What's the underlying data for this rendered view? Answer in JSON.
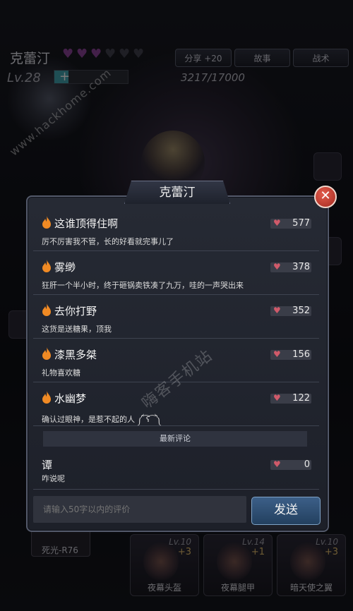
{
  "character": {
    "name": "克蕾汀",
    "level_label": "Lv.28",
    "hearts_filled": 3,
    "hearts_total": 6,
    "xp_text": "3217/17000",
    "xp_progress": 0.19,
    "xp_plus": "+"
  },
  "top_tabs": {
    "share": "分享 +20",
    "story": "故事",
    "tactics": "战术"
  },
  "watermark": {
    "url": "www.hackhome.com",
    "site": "嗨客手机站"
  },
  "modal": {
    "title": "克蕾汀",
    "close_label": "✕",
    "hot_comments": [
      {
        "user": "这谁顶得住啊",
        "likes": "577",
        "text": "厉不厉害我不管，长的好看就完事儿了"
      },
      {
        "user": "雾缈",
        "likes": "378",
        "text": "狂肝一个半小时，终于砸锅卖铁凑了九万，哇的一声哭出来"
      },
      {
        "user": "去你打野",
        "likes": "352",
        "text": "这货是送糖果，顶我"
      },
      {
        "user": "漆黑多桀",
        "likes": "156",
        "text": "礼物喜欢糖"
      },
      {
        "user": "水幽梦",
        "likes": "122",
        "text": "确认过眼神，是惹不起的人 ༼ ͡ʕ ͡ ༽"
      }
    ],
    "latest_label": "最新评论",
    "latest_comments": [
      {
        "user": "谭",
        "likes": "0",
        "text": "咋说呢"
      }
    ],
    "input_placeholder": "请输入50字以内的评价",
    "send_label": "发送"
  },
  "equipment": [
    {
      "name": "夜幕头盔",
      "level": "Lv.10",
      "plus": "+3"
    },
    {
      "name": "夜幕腿甲",
      "level": "Lv.14",
      "plus": "+1"
    },
    {
      "name": "暗天使之翼",
      "level": "Lv.10",
      "plus": "+3"
    }
  ],
  "left_slot": {
    "name": "死光-R76"
  },
  "colors": {
    "accent_blue": "#3c5f88",
    "flame": "#f08a24",
    "heart": "#d05a6a",
    "close_red": "#c8392c"
  }
}
